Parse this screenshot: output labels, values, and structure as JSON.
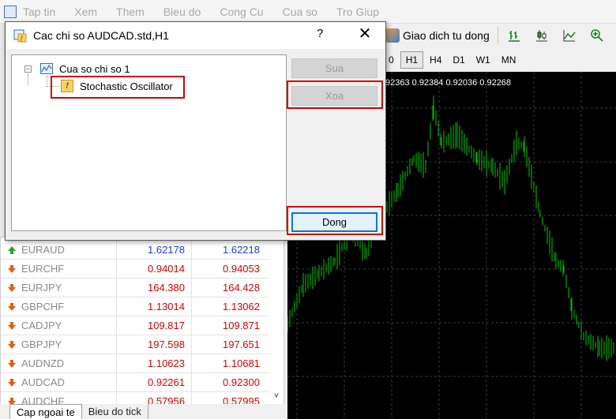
{
  "menu": {
    "items": [
      "Tap tin",
      "Xem",
      "Them",
      "Bieu do",
      "Cong Cu",
      "Cua so",
      "Tro Giup"
    ]
  },
  "toolbar": {
    "auto_trade_label": "Giao dich tu dong",
    "icons": [
      "bar-chart-icon",
      "candlestick-icon",
      "line-chart-icon",
      "zoom-in-icon"
    ]
  },
  "timeframes": {
    "items": [
      "0",
      "H1",
      "H4",
      "D1",
      "W1",
      "MN"
    ],
    "active": "H1"
  },
  "chart": {
    "ohlc_text": "92363 0.92384 0.92036 0.92268",
    "background": "#000000",
    "line_color": "#00c800",
    "grid_color": "#3a3a3a"
  },
  "market_watch": {
    "rows": [
      {
        "symbol": "EURAUD",
        "bid": "1.62178",
        "ask": "1.62218",
        "direction": "up"
      },
      {
        "symbol": "EURCHF",
        "bid": "0.94014",
        "ask": "0.94053",
        "direction": "down"
      },
      {
        "symbol": "EURJPY",
        "bid": "164.380",
        "ask": "164.428",
        "direction": "down"
      },
      {
        "symbol": "GBPCHF",
        "bid": "1.13014",
        "ask": "1.13062",
        "direction": "down"
      },
      {
        "symbol": "CADJPY",
        "bid": "109.817",
        "ask": "109.871",
        "direction": "down"
      },
      {
        "symbol": "GBPJPY",
        "bid": "197.598",
        "ask": "197.651",
        "direction": "down"
      },
      {
        "symbol": "AUDNZD",
        "bid": "1.10623",
        "ask": "1.10681",
        "direction": "down"
      },
      {
        "symbol": "AUDCAD",
        "bid": "0.92261",
        "ask": "0.92300",
        "direction": "down"
      },
      {
        "symbol": "AUDCHF",
        "bid": "0.57956",
        "ask": "0.57995",
        "direction": "down"
      }
    ],
    "colors": {
      "up": "#1f3ddb",
      "down": "#e00000",
      "up_arrow": "#2aa02a",
      "down_arrow": "#e06010"
    }
  },
  "bottom_tabs": {
    "active": "Cap ngoai te",
    "inactive": "Bieu do tick"
  },
  "dialog": {
    "title": "Cac chi so AUDCAD.std,H1",
    "help": "?",
    "close": "✕",
    "tree": {
      "window_label": "Cua so chi so 1",
      "expander": "−",
      "indicator_label": "Stochastic Oscillator",
      "indicator_icon_glyph": "f"
    },
    "buttons": {
      "edit": "Sua",
      "delete": "Xoa",
      "close": "Dong"
    },
    "highlight_color": "#d50000"
  }
}
